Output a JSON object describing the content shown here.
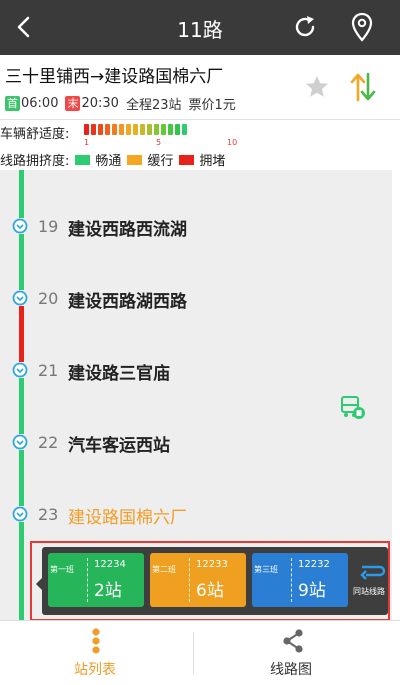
{
  "header": {
    "title": "11路"
  },
  "route": {
    "name": "三十里铺西→建设路国棉六厂",
    "first_badge": "首",
    "first_time": "06:00",
    "last_badge": "末",
    "last_time": "20:30",
    "total_stops": "全程23站",
    "fare": "票价1元"
  },
  "comfort": {
    "label": "车辆舒适度:",
    "scale_min": "1",
    "scale_mid": "5",
    "scale_max": "10"
  },
  "congestion": {
    "label": "线路拥挤度:",
    "legend": [
      {
        "label": "畅通",
        "color": "#2ecc71"
      },
      {
        "label": "缓行",
        "color": "#f5a623"
      },
      {
        "label": "拥堵",
        "color": "#e8221a"
      }
    ]
  },
  "stations": [
    {
      "number": "19",
      "name": "建设西路西流湖"
    },
    {
      "number": "20",
      "name": "建设西路湖西路"
    },
    {
      "number": "21",
      "name": "建设路三官庙"
    },
    {
      "number": "22",
      "name": "汽车客运西站"
    },
    {
      "number": "23",
      "name": "建设路国棉六厂",
      "current": true
    }
  ],
  "segment_colors": [
    "#2ecc71",
    "#2ecc71",
    "#e8221a",
    "#2ecc71",
    "#2ecc71",
    "#2ecc71"
  ],
  "buses": [
    {
      "order": "第一班",
      "plate": "12234",
      "distance": "2站",
      "color": "#26b559"
    },
    {
      "order": "第二班",
      "plate": "12233",
      "distance": "6站",
      "color": "#f0a020"
    },
    {
      "order": "第三班",
      "plate": "12232",
      "distance": "9站",
      "color": "#2a7fd4"
    }
  ],
  "same_line": {
    "label": "同站线路"
  },
  "tabs": [
    {
      "label": "站列表",
      "active": true
    },
    {
      "label": "线路图",
      "active": false
    }
  ],
  "colors": {
    "accent": "#f39c26",
    "topbar": "#3a3a3a",
    "node": "#29a8e0",
    "highlight_box": "#e53935"
  }
}
